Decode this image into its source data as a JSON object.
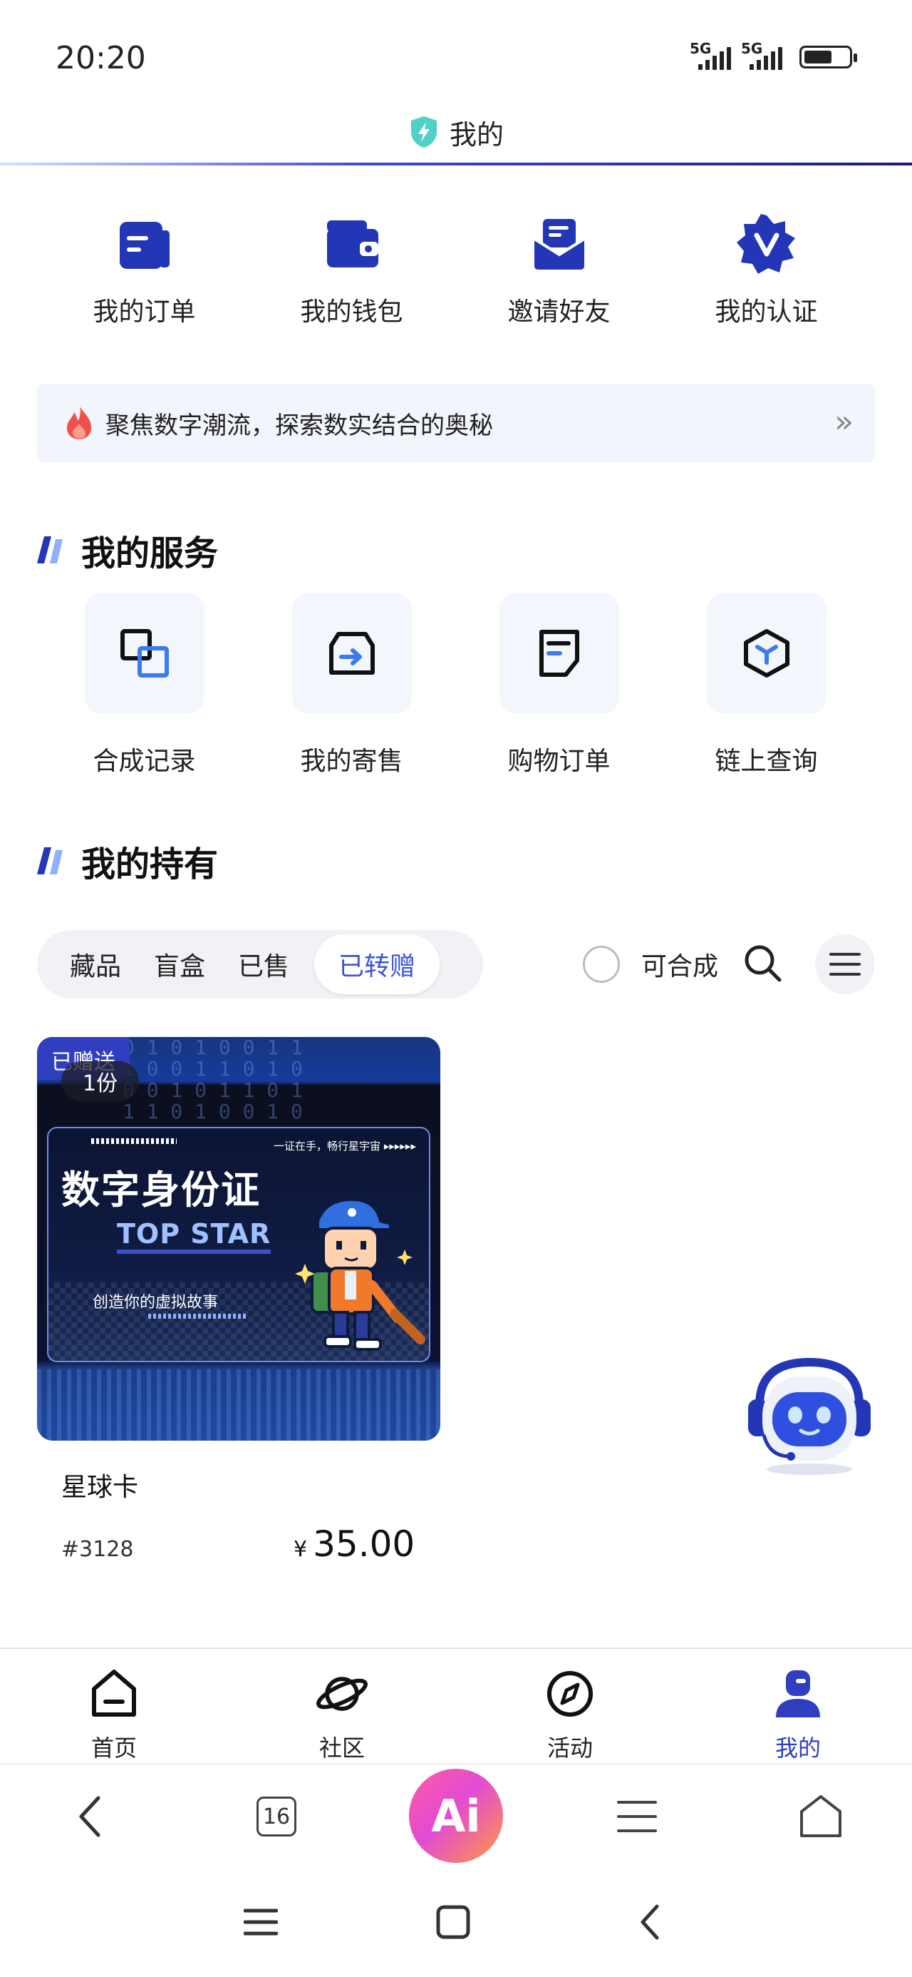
{
  "status_bar": {
    "time": "20:20",
    "signal1": "5G",
    "signal2": "5G",
    "battery_level": 0.6
  },
  "header": {
    "title": "我的",
    "icon": "shield-lightning-icon"
  },
  "quick_actions": [
    {
      "label": "我的订单",
      "icon": "order-icon"
    },
    {
      "label": "我的钱包",
      "icon": "wallet-icon"
    },
    {
      "label": "邀请好友",
      "icon": "invite-mail-icon"
    },
    {
      "label": "我的认证",
      "icon": "verified-badge-icon"
    }
  ],
  "banner": {
    "text": "聚焦数字潮流，探索数实结合的奥秘",
    "icon": "fire-icon",
    "arrow": "»"
  },
  "services": {
    "title": "我的服务",
    "items": [
      {
        "label": "合成记录",
        "icon": "merge-icon"
      },
      {
        "label": "我的寄售",
        "icon": "consign-box-icon"
      },
      {
        "label": "购物订单",
        "icon": "shopping-order-icon"
      },
      {
        "label": "链上查询",
        "icon": "blockchain-cube-icon"
      }
    ]
  },
  "holdings": {
    "title": "我的持有",
    "tabs": [
      "藏品",
      "盲盒",
      "已售",
      "已转赠"
    ],
    "active_tab": "已转赠",
    "synth_label": "可合成"
  },
  "card": {
    "badge": "已赠送",
    "copies": "1份",
    "image_text": {
      "top_line": "一证在手，畅行星宇宙 ▸▸▸▸▸▸",
      "title": "数字身份证",
      "subtitle": "TOP STAR",
      "story": "创造你的虚拟故事"
    },
    "name": "星球卡",
    "id": "#3128",
    "currency": "¥",
    "price": "35.00"
  },
  "bottom_nav": [
    {
      "label": "首页",
      "icon": "home-icon",
      "active": false
    },
    {
      "label": "社区",
      "icon": "planet-icon",
      "active": false
    },
    {
      "label": "活动",
      "icon": "compass-icon",
      "active": false
    },
    {
      "label": "我的",
      "icon": "user-icon",
      "active": true
    }
  ],
  "browser_bar": {
    "tab_count": "16",
    "ai_label": "Ai"
  },
  "colors": {
    "accent": "#3b55d9",
    "brand_blue": "#2f3fbf",
    "icon_blue": "#2336b5"
  }
}
